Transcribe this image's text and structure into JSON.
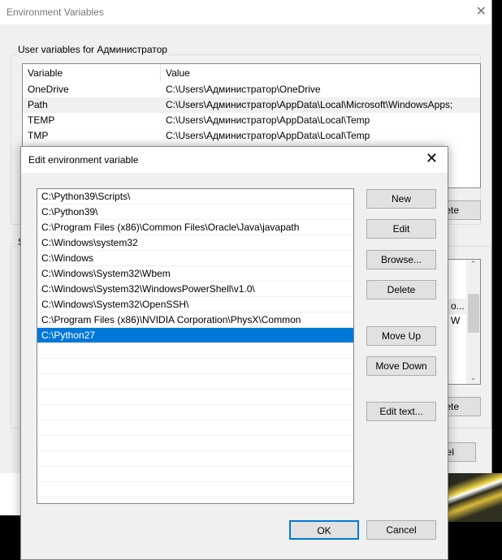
{
  "env_window": {
    "title": "Environment Variables",
    "user_group_label": "User variables for Администратор",
    "columns": [
      "Variable",
      "Value"
    ],
    "user_vars": [
      {
        "name": "OneDrive",
        "value": "C:\\Users\\Администратор\\OneDrive"
      },
      {
        "name": "Path",
        "value": "C:\\Users\\Администратор\\AppData\\Local\\Microsoft\\WindowsApps;"
      },
      {
        "name": "TEMP",
        "value": "C:\\Users\\Администратор\\AppData\\Local\\Temp"
      },
      {
        "name": "TMP",
        "value": "C:\\Users\\Администратор\\AppData\\Local\\Temp"
      }
    ],
    "user_delete_partial": "ete",
    "system_group_partial": "S",
    "system_partial_texts": [
      "o...",
      "W"
    ],
    "system_delete_partial": "ete",
    "cancel_partial": "el"
  },
  "edit_dialog": {
    "title": "Edit environment variable",
    "entries": [
      "C:\\Python39\\Scripts\\",
      "C:\\Python39\\",
      "C:\\Program Files (x86)\\Common Files\\Oracle\\Java\\javapath",
      "C:\\Windows\\system32",
      "C:\\Windows",
      "C:\\Windows\\System32\\Wbem",
      "C:\\Windows\\System32\\WindowsPowerShell\\v1.0\\",
      "C:\\Windows\\System32\\OpenSSH\\",
      "C:\\Program Files (x86)\\NVIDIA Corporation\\PhysX\\Common",
      "C:\\Python27"
    ],
    "selected_index": 9,
    "buttons": {
      "new": "New",
      "edit": "Edit",
      "browse": "Browse...",
      "delete": "Delete",
      "move_up": "Move Up",
      "move_down": "Move Down",
      "edit_text": "Edit text...",
      "ok": "OK",
      "cancel": "Cancel"
    }
  },
  "colors": {
    "selection": "#0078d7",
    "dialog_bg": "#f0f0f0"
  }
}
